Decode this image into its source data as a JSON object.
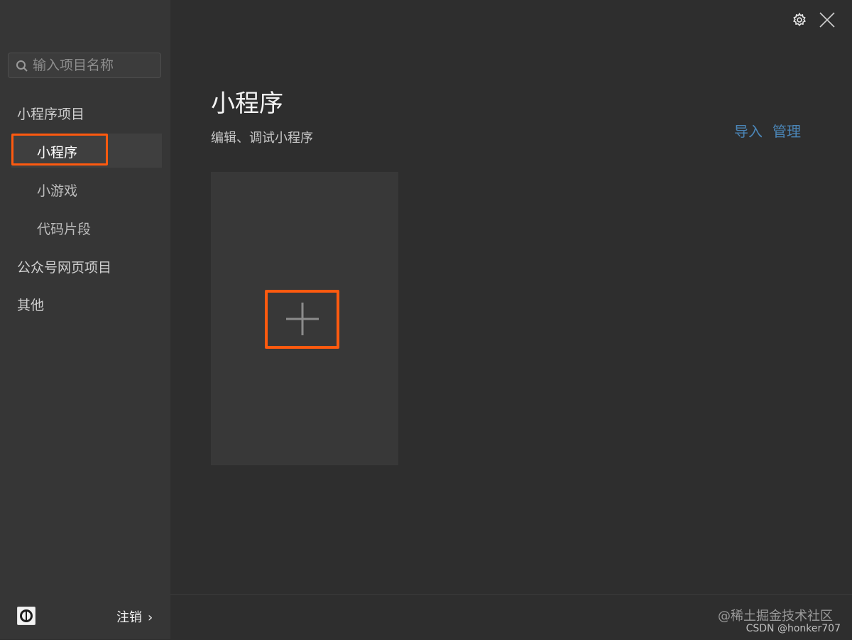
{
  "sidebar": {
    "search_placeholder": "输入项目名称",
    "groups": [
      {
        "label": "小程序项目",
        "items": [
          {
            "label": "小程序",
            "active": true
          },
          {
            "label": "小游戏"
          },
          {
            "label": "代码片段"
          }
        ]
      },
      {
        "label": "公众号网页项目"
      },
      {
        "label": "其他"
      }
    ],
    "logout_label": "注销",
    "logout_chevron": "›"
  },
  "main": {
    "title": "小程序",
    "subtitle": "编辑、调试小程序",
    "import_label": "导入",
    "manage_label": "管理"
  },
  "footer": {
    "watermark_line1": "@稀土掘金技术社区",
    "watermark_line2": "CSDN @honker707"
  },
  "colors": {
    "highlight": "#ff5a0f",
    "link": "#4b86b8",
    "sidebar_bg": "#363636",
    "main_bg": "#2e2e2e"
  },
  "icons": [
    "search-icon",
    "settings-icon",
    "close-icon",
    "plus-icon",
    "avatar-icon",
    "chevron-right-icon"
  ]
}
